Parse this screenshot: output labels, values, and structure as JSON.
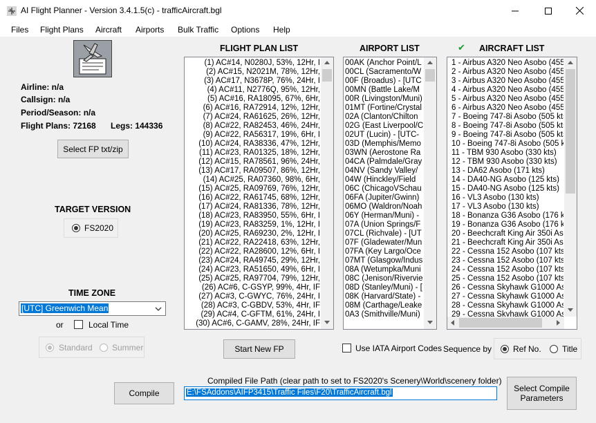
{
  "window": {
    "title": "AI Flight Planner - Version 3.4.1.5(c) - trafficAircraft.bgl"
  },
  "menu": [
    "Files",
    "Flight Plans",
    "Aircraft",
    "Airports",
    "Bulk Traffic",
    "Options",
    "Help"
  ],
  "info": {
    "airline": "Airline: n/a",
    "callsign": "Callsign: n/a",
    "period": "Period/Season: n/a",
    "flight_plans": "Flight Plans: 72168",
    "legs": "Legs: 144336"
  },
  "buttons": {
    "select_fp": "Select FP txt/zip",
    "start_new_fp": "Start New FP",
    "compile": "Compile",
    "select_compile_params_line1": "Select Compile",
    "select_compile_params_line2": "Parameters"
  },
  "target_version": {
    "title": "TARGET VERSION",
    "option": "FS2020"
  },
  "time_zone": {
    "title": "TIME ZONE",
    "selected": "[UTC] Greenwich Mean",
    "or": "or",
    "local_time": "Local Time",
    "standard": "Standard",
    "summer": "Summer"
  },
  "flight_plan_list": {
    "title": "FLIGHT PLAN LIST",
    "items": [
      "(1) AC#14, N0280J, 53%, 12Hr, I",
      "(2) AC#15, N2021M, 78%, 12Hr,",
      "(3) AC#17, N3678P, 76%, 24Hr, I",
      "(4) AC#11, N2776Q, 95%, 12Hr,",
      "(5) AC#16, RA18095, 67%, 6Hr,",
      "(6) AC#16, RA72914, 12%, 12Hr,",
      "(7) AC#24, RA61625, 26%, 12Hr,",
      "(8) AC#22, RA82453, 46%, 24Hr,",
      "(9) AC#22, RA56317, 19%, 6Hr, I",
      "(10) AC#24, RA38336, 47%, 12Hr,",
      "(11) AC#23, RA01325, 18%, 12Hr,",
      "(12) AC#15, RA78561, 96%, 24Hr,",
      "(13) AC#17, RA09507, 86%, 12Hr,",
      "(14) AC#25, RA07360, 98%, 6Hr,",
      "(15) AC#25, RA09769, 76%, 12Hr,",
      "(16) AC#22, RA61745, 68%, 12Hr,",
      "(17) AC#24, RA81336, 78%, 12Hr,",
      "(18) AC#23, RA83950, 55%, 6Hr, I",
      "(19) AC#23, RA83259, 1%, 12Hr, I",
      "(20) AC#25, RA69230, 2%, 12Hr, I",
      "(21) AC#22, RA22418, 63%, 12Hr,",
      "(22) AC#22, RA28600, 12%, 6Hr, I",
      "(23) AC#24, RA49745, 29%, 12Hr,",
      "(24) AC#23, RA51650, 49%, 6Hr, I",
      "(25) AC#25, RA97704, 79%, 12Hr,",
      "(26) AC#6, C-GSYP, 99%, 4Hr, IF",
      "(27) AC#3, C-GWYC, 76%, 24Hr, I",
      "(28) AC#3, C-GBDV, 53%, 4Hr, IF",
      "(29) AC#4, C-GFTM, 61%, 24Hr, I",
      "(30) AC#6, C-GAMV, 28%, 24Hr, IF"
    ]
  },
  "airport_list": {
    "title": "AIRPORT LIST",
    "items": [
      "00AK (Anchor Point/L",
      "00CL (Sacramento/W",
      "00F (Broadus) - [UTC",
      "00MN (Battle Lake/M",
      "00R (Livingston/Muni)",
      "01MT (Fortine/Crystal",
      "02A (Clanton/Chilton",
      "02G (East Liverpool/C",
      "02UT (Lucin) - [UTC-",
      "03D (Memphis/Memo",
      "03WN (Aerostone Ra",
      "04CA (Palmdale/Gray",
      "04NV (Sandy Valley/",
      "04W (Hinckley/Field",
      "06C (ChicagoVSchau",
      "06FA (Jupiter/Gwinn)",
      "06MO (Waldron/Noah",
      "06Y (Herman/Muni) -",
      "07A (Union Springs/F",
      "07CL (Richvale) - [UT",
      "07F (Gladewater/Mun",
      "07FA (Key Largo/Oce",
      "07MT (Glasgow/Indus",
      "08A (Wetumpka/Muni",
      "08C (Jenison/Rivervie",
      "08D (Stanley/Muni) - [",
      "08K (Harvard/State) -",
      "08M (Carthage/Leake",
      "0A3 (Smithville/Muni)"
    ]
  },
  "aircraft_list": {
    "title": "AIRCRAFT LIST",
    "check": "✔",
    "items": [
      "1 - Airbus A320 Neo Asobo (455",
      "2 - Airbus A320 Neo Asobo (455",
      "3 - Airbus A320 Neo Asobo (455",
      "4 - Airbus A320 Neo Asobo (455",
      "5 - Airbus A320 Neo Asobo (455",
      "6 - Airbus A320 Neo Asobo (455",
      "7 - Boeing 747-8i Asobo (505 kts",
      "8 - Boeing 747-8i Asobo (505 kts",
      "9 - Boeing 747-8i Asobo (505 kts",
      "10 - Boeing 747-8i Asobo (505 ks",
      "11 - TBM 930 Asobo (330 kts)",
      "12 - TBM 930 Asobo (330 kts)",
      "13 - DA62 Asobo (171 kts)",
      "14 - DA40-NG Asobo (125 kts)",
      "15 - DA40-NG Asobo (125 kts)",
      "16 - VL3 Asobo (130 kts)",
      "17 - VL3 Asobo (130 kts)",
      "18 - Bonanza G36 Asobo (176 kts",
      "19 - Bonanza G36 Asobo (176 kts",
      "20 - Beechcraft King Air 350i Asob",
      "21 - Beechcraft King Air 350i Asob",
      "22 - Cessna 152 Asobo (107 kts)",
      "23 - Cessna 152 Asobo (107 kts)",
      "24 - Cessna 152 Asobo (107 kts)",
      "25 - Cessna 152 Asobo (107 kts)",
      "26 - Cessna Skyhawk G1000 Aso",
      "27 - Cessna Skyhawk G1000 Aso",
      "28 - Cessna Skyhawk G1000 Aso",
      "29 - Cessna Skyhawk G1000 Aso"
    ]
  },
  "options": {
    "use_iata": "Use IATA Airport Codes",
    "sequence_by": "Sequence by",
    "ref_no": "Ref No.",
    "title_opt": "Title"
  },
  "compile": {
    "path_label": "Compiled File Path (clear path to set to FS2020's Scenery\\World\\scenery folder)",
    "path_value": "E:\\FSAddons\\AIFP3415\\Traffic Files\\F20\\TrafficAircraft.bgl"
  },
  "colors": {
    "selection": "#0078d7",
    "check_green": "#1a9c2c"
  }
}
